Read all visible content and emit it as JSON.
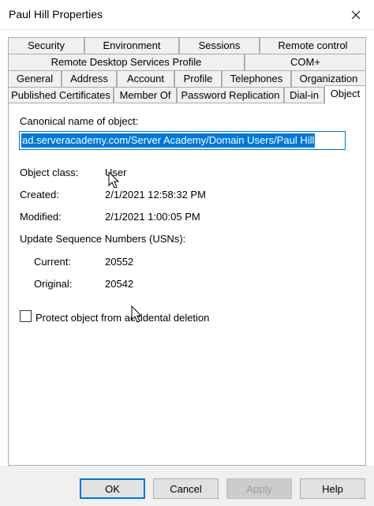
{
  "window": {
    "title": "Paul Hill Properties"
  },
  "tabs": {
    "row1": [
      "Security",
      "Environment",
      "Sessions",
      "Remote control"
    ],
    "row2": [
      "Remote Desktop Services Profile",
      "COM+"
    ],
    "row3": [
      "General",
      "Address",
      "Account",
      "Profile",
      "Telephones",
      "Organization"
    ],
    "row4": [
      "Published Certificates",
      "Member Of",
      "Password Replication",
      "Dial-in",
      "Object"
    ],
    "selected": "Object"
  },
  "object_tab": {
    "canonical_label": "Canonical name of object:",
    "canonical_value": "ad.serveracademy.com/Server Academy/Domain Users/Paul Hill",
    "object_class_label": "Object class:",
    "object_class_value": "User",
    "created_label": "Created:",
    "created_value": "2/1/2021 12:58:32 PM",
    "modified_label": "Modified:",
    "modified_value": "2/1/2021 1:00:05 PM",
    "usn_label": "Update Sequence Numbers (USNs):",
    "current_label": "Current:",
    "current_value": "20552",
    "original_label": "Original:",
    "original_value": "20542",
    "protect_label": "Protect object from accidental deletion",
    "protect_checked": false
  },
  "buttons": {
    "ok": "OK",
    "cancel": "Cancel",
    "apply": "Apply",
    "help": "Help"
  },
  "icons": {
    "close": "close-icon",
    "cursor": "mouse-pointer-icon"
  },
  "colors": {
    "accent": "#0078d7",
    "tab_bg": "#f0f0f0",
    "border": "#adadad"
  }
}
